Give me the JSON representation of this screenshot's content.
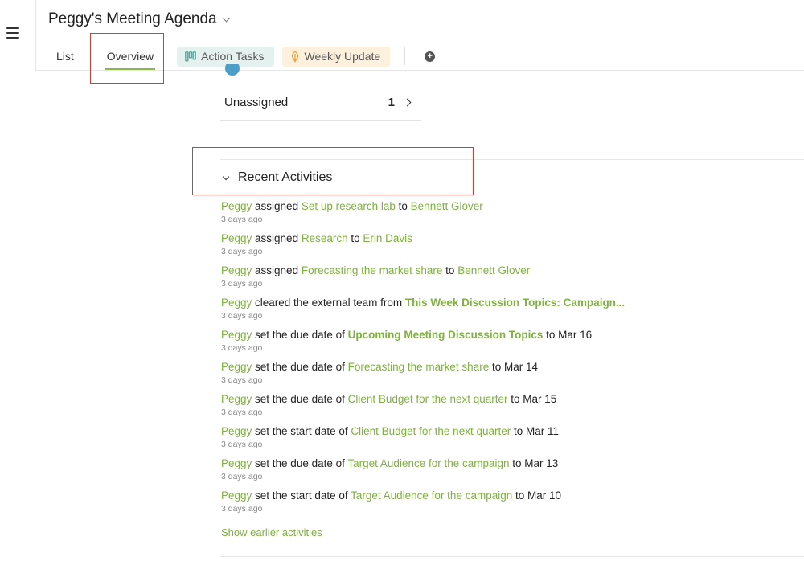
{
  "app": {
    "menu_icon": "hamburger-icon"
  },
  "header": {
    "title": "Peggy's Meeting Agenda",
    "tabs": [
      {
        "label": "List"
      },
      {
        "label": "Overview",
        "active": true
      },
      {
        "label": "Action Tasks",
        "icon": "board-icon"
      },
      {
        "label": "Weekly Update",
        "icon": "leaf-icon"
      }
    ],
    "add_tab_icon": "plus-circle-icon"
  },
  "members": {
    "unassigned_label": "Unassigned",
    "unassigned_count": "1"
  },
  "recent": {
    "title": "Recent Activities",
    "activities": [
      {
        "parts": [
          {
            "t": "Peggy",
            "s": "g"
          },
          {
            "t": " assigned ",
            "s": ""
          },
          {
            "t": "Set up research lab",
            "s": "g"
          },
          {
            "t": " to ",
            "s": ""
          },
          {
            "t": "Bennett Glover",
            "s": "g"
          }
        ],
        "time": "3 days ago"
      },
      {
        "parts": [
          {
            "t": "Peggy",
            "s": "g"
          },
          {
            "t": " assigned ",
            "s": ""
          },
          {
            "t": "Research",
            "s": "g"
          },
          {
            "t": " to ",
            "s": ""
          },
          {
            "t": "Erin Davis",
            "s": "g"
          }
        ],
        "time": "3 days ago"
      },
      {
        "parts": [
          {
            "t": "Peggy",
            "s": "g"
          },
          {
            "t": " assigned ",
            "s": ""
          },
          {
            "t": "Forecasting the market share",
            "s": "g"
          },
          {
            "t": " to ",
            "s": ""
          },
          {
            "t": "Bennett Glover",
            "s": "g"
          }
        ],
        "time": "3 days ago"
      },
      {
        "parts": [
          {
            "t": "Peggy",
            "s": "g"
          },
          {
            "t": " cleared the external team from ",
            "s": ""
          },
          {
            "t": "This Week Discussion Topics: Campaign...",
            "s": "gb"
          }
        ],
        "time": "3 days ago"
      },
      {
        "parts": [
          {
            "t": "Peggy",
            "s": "g"
          },
          {
            "t": " set the due date of ",
            "s": ""
          },
          {
            "t": "Upcoming Meeting Discussion Topics",
            "s": "gb"
          },
          {
            "t": " to Mar 16",
            "s": ""
          }
        ],
        "time": "3 days ago"
      },
      {
        "parts": [
          {
            "t": "Peggy",
            "s": "g"
          },
          {
            "t": " set the due date of ",
            "s": ""
          },
          {
            "t": "Forecasting the market share",
            "s": "g"
          },
          {
            "t": " to Mar 14",
            "s": ""
          }
        ],
        "time": "3 days ago"
      },
      {
        "parts": [
          {
            "t": "Peggy",
            "s": "g"
          },
          {
            "t": " set the due date of ",
            "s": ""
          },
          {
            "t": "Client Budget for the next quarter",
            "s": "g"
          },
          {
            "t": " to Mar 15",
            "s": ""
          }
        ],
        "time": "3 days ago"
      },
      {
        "parts": [
          {
            "t": "Peggy",
            "s": "g"
          },
          {
            "t": " set the start date of ",
            "s": ""
          },
          {
            "t": "Client Budget for the next quarter",
            "s": "g"
          },
          {
            "t": " to Mar 11",
            "s": ""
          }
        ],
        "time": "3 days ago"
      },
      {
        "parts": [
          {
            "t": "Peggy",
            "s": "g"
          },
          {
            "t": " set the due date of ",
            "s": ""
          },
          {
            "t": "Target Audience for the campaign",
            "s": "g"
          },
          {
            "t": " to Mar 13",
            "s": ""
          }
        ],
        "time": "3 days ago"
      },
      {
        "parts": [
          {
            "t": "Peggy",
            "s": "g"
          },
          {
            "t": " set the start date of ",
            "s": ""
          },
          {
            "t": "Target Audience for the campaign",
            "s": "g"
          },
          {
            "t": " to Mar 10",
            "s": ""
          }
        ],
        "time": "3 days ago"
      }
    ],
    "show_earlier": "Show earlier activities"
  },
  "colors": {
    "accent_green": "#7fb041",
    "highlight_red": "#e03a2f",
    "avatar_blue": "#4c9ec8"
  }
}
